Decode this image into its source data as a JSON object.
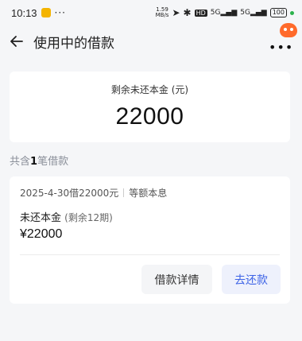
{
  "status_bar": {
    "time": "10:13",
    "dots": "···",
    "speed_value": "1.59",
    "speed_unit": "MB/s",
    "hd_label": "HD",
    "signal1": "5G",
    "signal2": "5G",
    "battery": "100"
  },
  "header": {
    "title": "使用中的借款"
  },
  "summary": {
    "label": "剩余未还本金 (元)",
    "amount": "22000"
  },
  "count_line": {
    "prefix": "共含",
    "count": "1",
    "suffix": "笔借款"
  },
  "loan": {
    "meta_left": "2025-4-30借22000元",
    "meta_right": "等额本息",
    "principal_label": "未还本金",
    "principal_sub": "(剩余12期)",
    "principal_amount": "¥22000",
    "detail_button": "借款详情",
    "repay_button": "去还款"
  },
  "colors": {
    "accent": "#3d63e6",
    "background": "#f5f6f8",
    "mascot": "#ff6a2b"
  },
  "icons": {
    "back": "back-arrow-icon",
    "more": "more-icon",
    "mascot": "mascot-icon"
  }
}
